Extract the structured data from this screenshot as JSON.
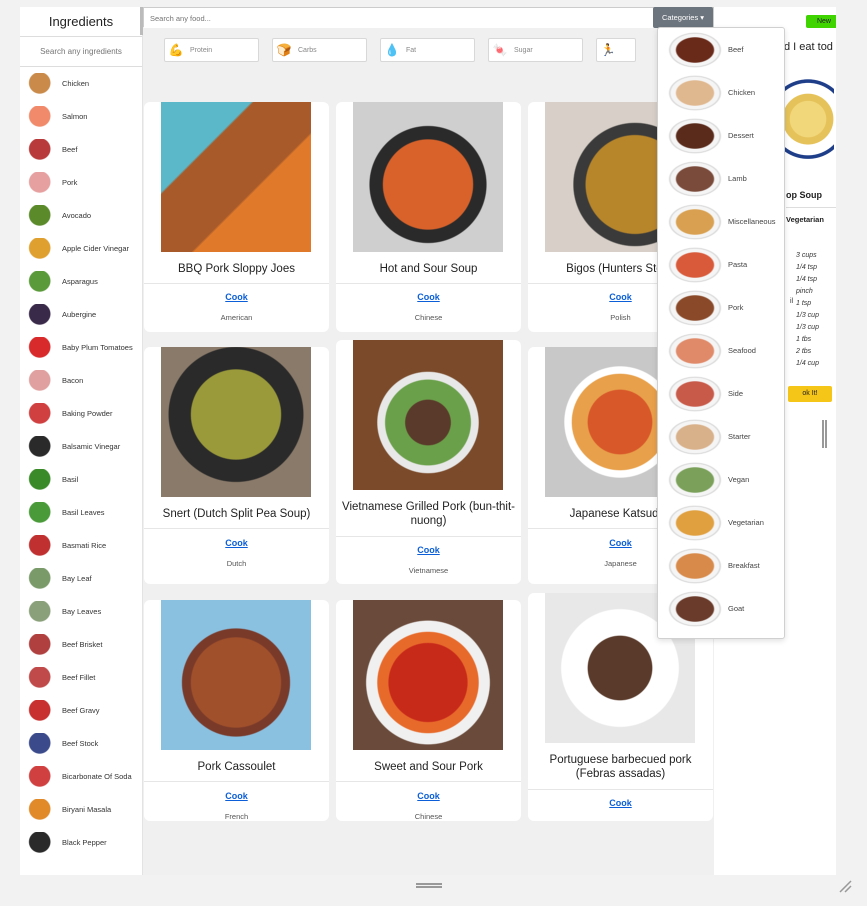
{
  "sidebar": {
    "title": "Ingredients",
    "search_placeholder": "Search any ingredients",
    "items": [
      {
        "label": "Chicken",
        "color": "#c98a4a"
      },
      {
        "label": "Salmon",
        "color": "#f08a6a"
      },
      {
        "label": "Beef",
        "color": "#b83a3a"
      },
      {
        "label": "Pork",
        "color": "#e6a0a0"
      },
      {
        "label": "Avocado",
        "color": "#5a8a2a"
      },
      {
        "label": "Apple Cider Vinegar",
        "color": "#e0a030"
      },
      {
        "label": "Asparagus",
        "color": "#5a9a3a"
      },
      {
        "label": "Aubergine",
        "color": "#3a2a4a"
      },
      {
        "label": "Baby Plum Tomatoes",
        "color": "#d82a2a"
      },
      {
        "label": "Bacon",
        "color": "#e0a0a0"
      },
      {
        "label": "Baking Powder",
        "color": "#d04040"
      },
      {
        "label": "Balsamic Vinegar",
        "color": "#2a2a2a"
      },
      {
        "label": "Basil",
        "color": "#3a8a2a"
      },
      {
        "label": "Basil Leaves",
        "color": "#4a9a3a"
      },
      {
        "label": "Basmati Rice",
        "color": "#c03030"
      },
      {
        "label": "Bay Leaf",
        "color": "#7a9a6a"
      },
      {
        "label": "Bay Leaves",
        "color": "#8aa07a"
      },
      {
        "label": "Beef Brisket",
        "color": "#b04040"
      },
      {
        "label": "Beef Fillet",
        "color": "#c04a4a"
      },
      {
        "label": "Beef Gravy",
        "color": "#c83030"
      },
      {
        "label": "Beef Stock",
        "color": "#3a4a8a"
      },
      {
        "label": "Bicarbonate Of Soda",
        "color": "#d04040"
      },
      {
        "label": "Biryani Masala",
        "color": "#e08a2a"
      },
      {
        "label": "Black Pepper",
        "color": "#2a2a2a"
      }
    ]
  },
  "search": {
    "placeholder": "Search any food..."
  },
  "categories_button": "Categories ▾",
  "filters": [
    {
      "label": "Protein",
      "icon": "protein-icon",
      "glyph": "💪"
    },
    {
      "label": "Carbs",
      "icon": "carbs-icon",
      "glyph": "🍞"
    },
    {
      "label": "Fat",
      "icon": "fat-icon",
      "glyph": "💧"
    },
    {
      "label": "Sugar",
      "icon": "sugar-icon",
      "glyph": "🍬"
    },
    {
      "label": "",
      "icon": "calories-icon",
      "glyph": "🏃"
    }
  ],
  "recipes": [
    {
      "title": "BBQ Pork Sloppy Joes",
      "cook": "Cook",
      "cuisine": "American",
      "bg": "linear-gradient(135deg,#5bb8c8 0 30%,#a85a2a 31% 60%,#e07a2a 61%)"
    },
    {
      "title": "Hot and Sour Soup",
      "cook": "Cook",
      "cuisine": "Chinese",
      "bg": "radial-gradient(circle at 50% 55%,#d8622a 0 40%,#2a2a2a 41% 52%,#cfcfcf 53%)"
    },
    {
      "title": "Bigos (Hunters Stew)",
      "cook": "Cook",
      "cuisine": "Polish",
      "bg": "radial-gradient(circle at 60% 55%,#b8862a 0 40%,#3a3a3a 41% 50%,#d8d0c8 51%)"
    },
    {
      "title": "Snert (Dutch Split Pea Soup)",
      "cook": "Cook",
      "cuisine": "Dutch",
      "bg": "radial-gradient(circle at 50% 45%,#9a9a3a 0 40%,#2a2a2a 41% 60%,#8a7a6a 61%)"
    },
    {
      "title": "Vietnamese Grilled Pork (bun-thit-nuong)",
      "cook": "Cook",
      "cuisine": "Vietnamese",
      "bg": "radial-gradient(circle at 50% 55%,#5a3a2a 0 20%,#6aa04a 21% 38%,#e8e8e8 39% 45%,#7a4a2a 46%)"
    },
    {
      "title": "Japanese Katsudon",
      "cook": "Cook",
      "cuisine": "Japanese",
      "bg": "radial-gradient(circle at 50% 50%,#d8582a 0 30%,#e8a04a 31% 45%,#ffffff 46% 52%,#c8c8c8 53%)"
    },
    {
      "title": "Pork Cassoulet",
      "cook": "Cook",
      "cuisine": "French",
      "bg": "radial-gradient(circle at 50% 55%,#a0502a 0 40%,#7a3a2a 41% 48%,#8ac0e0 49%)"
    },
    {
      "title": "Sweet and Sour Pork",
      "cook": "Cook",
      "cuisine": "Chinese",
      "bg": "radial-gradient(circle at 50% 55%,#c82a1a 0 35%,#e86a2a 36% 45%,#f0f0f0 46% 55%,#6a4a3a 56%)"
    },
    {
      "title": "Portuguese barbecued pork (Febras assadas)",
      "cook": "Cook",
      "cuisine": "",
      "bg": "radial-gradient(circle at 50% 50%,#5a3a2a 0 30%,#ffffff 31% 55%,#e8e8e8 56%)"
    }
  ],
  "category_menu": [
    {
      "label": "Beef",
      "color": "#6a2a1a"
    },
    {
      "label": "Chicken",
      "color": "#e0b890"
    },
    {
      "label": "Dessert",
      "color": "#5a2a1a"
    },
    {
      "label": "Lamb",
      "color": "#7a4a3a"
    },
    {
      "label": "Miscellaneous",
      "color": "#d8a050"
    },
    {
      "label": "Pasta",
      "color": "#d85a3a"
    },
    {
      "label": "Pork",
      "color": "#8a4a2a"
    },
    {
      "label": "Seafood",
      "color": "#e08a6a"
    },
    {
      "label": "Side",
      "color": "#c85a4a"
    },
    {
      "label": "Starter",
      "color": "#d8b08a"
    },
    {
      "label": "Vegan",
      "color": "#7aa05a"
    },
    {
      "label": "Vegetarian",
      "color": "#e0a040"
    },
    {
      "label": "Breakfast",
      "color": "#d88a4a"
    },
    {
      "label": "Goat",
      "color": "#6a3a2a"
    }
  ],
  "right_panel": {
    "badge": "New",
    "question": "d I eat tod",
    "title": "op Soup",
    "tag": "Vegetarian",
    "quantities": [
      "3 cups",
      "1/4 tsp",
      "1/4 tsp",
      "pinch",
      "1 tsp",
      "1/3 cup",
      "1/3 cup",
      "1 tbs",
      "2 tbs",
      "1/4 cup"
    ],
    "trunc": "il",
    "button": "ok It!"
  }
}
